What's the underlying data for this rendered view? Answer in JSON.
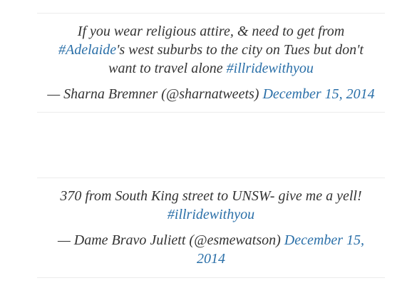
{
  "tweets": [
    {
      "text_before": "If you wear religious attire, & need to get from ",
      "hashtag_1": "#Adelaide",
      "text_middle": "'s west suburbs to the city on Tues but don't want to travel alone ",
      "hashtag_2": "#illridewithyou",
      "attribution": "— Sharna Bremner (@sharnatweets) ",
      "date": "December 15, 2014"
    },
    {
      "text_before": "370 from South King street to UNSW- give me a yell! ",
      "hashtag_1": "#illridewithyou",
      "attribution": "— Dame Bravo Juliett (@esmewatson) ",
      "date": "December 15, 2014"
    }
  ],
  "colors": {
    "text": "#333333",
    "link": "#2a6fa8",
    "divider": "#ececec"
  }
}
